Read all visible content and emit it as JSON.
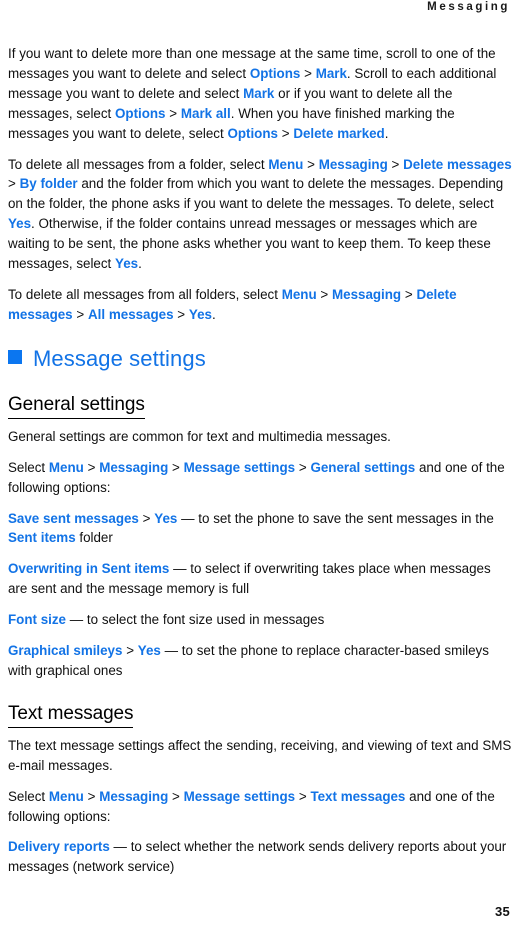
{
  "header": {
    "running_title": "Messaging"
  },
  "colors": {
    "ui_term": "#1273e6",
    "chapter_heading": "#1273e6",
    "bullet_square": "#0b76f0",
    "body_text": "#101010"
  },
  "body": {
    "paragraphs": [
      {
        "id": "p-delete-multiple",
        "runs": [
          {
            "t": "If you want to delete more than one message at the same time, scroll to one of the messages you want to delete and select ",
            "s": "plain"
          },
          {
            "t": "Options",
            "s": "ui"
          },
          {
            "t": " > ",
            "s": "sep"
          },
          {
            "t": "Mark",
            "s": "ui"
          },
          {
            "t": ". Scroll to each additional message you want to delete and select ",
            "s": "plain"
          },
          {
            "t": "Mark",
            "s": "ui"
          },
          {
            "t": " or if you want to delete all the messages, select ",
            "s": "plain"
          },
          {
            "t": "Options",
            "s": "ui"
          },
          {
            "t": " > ",
            "s": "sep"
          },
          {
            "t": "Mark all",
            "s": "ui"
          },
          {
            "t": ". When you have finished marking the messages you want to delete, select ",
            "s": "plain"
          },
          {
            "t": "Options",
            "s": "ui"
          },
          {
            "t": " > ",
            "s": "sep"
          },
          {
            "t": "Delete marked",
            "s": "ui"
          },
          {
            "t": ".",
            "s": "plain"
          }
        ]
      },
      {
        "id": "p-delete-folder",
        "runs": [
          {
            "t": "To delete all messages from a folder, select ",
            "s": "plain"
          },
          {
            "t": "Menu",
            "s": "ui"
          },
          {
            "t": " > ",
            "s": "sep"
          },
          {
            "t": "Messaging",
            "s": "ui"
          },
          {
            "t": " > ",
            "s": "sep"
          },
          {
            "t": "Delete messages",
            "s": "ui"
          },
          {
            "t": " > ",
            "s": "sep"
          },
          {
            "t": "By folder",
            "s": "ui"
          },
          {
            "t": " and the folder from which you want to delete the messages. Depending on the folder, the phone asks if you want to delete the messages. To delete, select ",
            "s": "plain"
          },
          {
            "t": "Yes",
            "s": "ui"
          },
          {
            "t": ". Otherwise, if the folder contains unread messages or messages which are waiting to be sent, the phone asks whether you want to keep them. To keep these messages, select ",
            "s": "plain"
          },
          {
            "t": "Yes",
            "s": "ui"
          },
          {
            "t": ".",
            "s": "plain"
          }
        ]
      },
      {
        "id": "p-delete-all-folders",
        "runs": [
          {
            "t": "To delete all messages from all folders, select ",
            "s": "plain"
          },
          {
            "t": "Menu",
            "s": "ui"
          },
          {
            "t": " > ",
            "s": "sep"
          },
          {
            "t": "Messaging",
            "s": "ui"
          },
          {
            "t": " > ",
            "s": "sep"
          },
          {
            "t": "Delete messages",
            "s": "ui"
          },
          {
            "t": " > ",
            "s": "sep"
          },
          {
            "t": "All messages",
            "s": "ui"
          },
          {
            "t": " > ",
            "s": "sep"
          },
          {
            "t": "Yes",
            "s": "ui"
          },
          {
            "t": ".",
            "s": "plain"
          }
        ]
      }
    ]
  },
  "chapter": {
    "bullet_icon": "filled-square-icon",
    "title": "Message settings"
  },
  "sections": [
    {
      "id": "general-settings",
      "heading": "General settings",
      "paragraphs": [
        {
          "id": "p-general-intro",
          "runs": [
            {
              "t": "General settings are common for text and multimedia messages.",
              "s": "plain"
            }
          ]
        },
        {
          "id": "p-general-path",
          "runs": [
            {
              "t": "Select ",
              "s": "plain"
            },
            {
              "t": "Menu",
              "s": "ui"
            },
            {
              "t": " > ",
              "s": "sep"
            },
            {
              "t": "Messaging",
              "s": "ui"
            },
            {
              "t": " > ",
              "s": "sep"
            },
            {
              "t": "Message settings",
              "s": "ui"
            },
            {
              "t": " > ",
              "s": "sep"
            },
            {
              "t": "General settings",
              "s": "ui"
            },
            {
              "t": " and one of the following options:",
              "s": "plain"
            }
          ]
        },
        {
          "id": "p-opt-save-sent",
          "runs": [
            {
              "t": "Save sent messages",
              "s": "ui"
            },
            {
              "t": " > ",
              "s": "sep"
            },
            {
              "t": "Yes",
              "s": "ui"
            },
            {
              "t": " — to set the phone to save the sent messages in the ",
              "s": "dash"
            },
            {
              "t": "Sent items",
              "s": "ui"
            },
            {
              "t": " folder",
              "s": "plain"
            }
          ]
        },
        {
          "id": "p-opt-overwriting",
          "runs": [
            {
              "t": "Overwriting in Sent items",
              "s": "ui"
            },
            {
              "t": " — to select if overwriting takes place when messages are sent and the message memory is full",
              "s": "dash"
            }
          ]
        },
        {
          "id": "p-opt-font-size",
          "runs": [
            {
              "t": "Font size",
              "s": "ui"
            },
            {
              "t": " — to select the font size used in messages",
              "s": "dash"
            }
          ]
        },
        {
          "id": "p-opt-smileys",
          "runs": [
            {
              "t": "Graphical smileys",
              "s": "ui"
            },
            {
              "t": " > ",
              "s": "sep"
            },
            {
              "t": "Yes",
              "s": "ui"
            },
            {
              "t": " — to set the phone to replace character-based smileys with graphical ones",
              "s": "dash"
            }
          ]
        }
      ]
    },
    {
      "id": "text-messages",
      "heading": "Text messages",
      "paragraphs": [
        {
          "id": "p-text-intro",
          "runs": [
            {
              "t": "The text message settings affect the sending, receiving, and viewing of text and SMS e-mail messages.",
              "s": "plain"
            }
          ]
        },
        {
          "id": "p-text-path",
          "runs": [
            {
              "t": "Select ",
              "s": "plain"
            },
            {
              "t": "Menu",
              "s": "ui"
            },
            {
              "t": " > ",
              "s": "sep"
            },
            {
              "t": "Messaging",
              "s": "ui"
            },
            {
              "t": " > ",
              "s": "sep"
            },
            {
              "t": "Message settings",
              "s": "ui"
            },
            {
              "t": " > ",
              "s": "sep"
            },
            {
              "t": "Text messages",
              "s": "ui"
            },
            {
              "t": " and one of the following options:",
              "s": "plain"
            }
          ]
        },
        {
          "id": "p-opt-delivery-reports",
          "runs": [
            {
              "t": "Delivery reports",
              "s": "ui"
            },
            {
              "t": " — to select whether the network sends delivery reports about your messages (network service)",
              "s": "dash"
            }
          ]
        }
      ]
    }
  ],
  "footer": {
    "page_number": "35"
  }
}
